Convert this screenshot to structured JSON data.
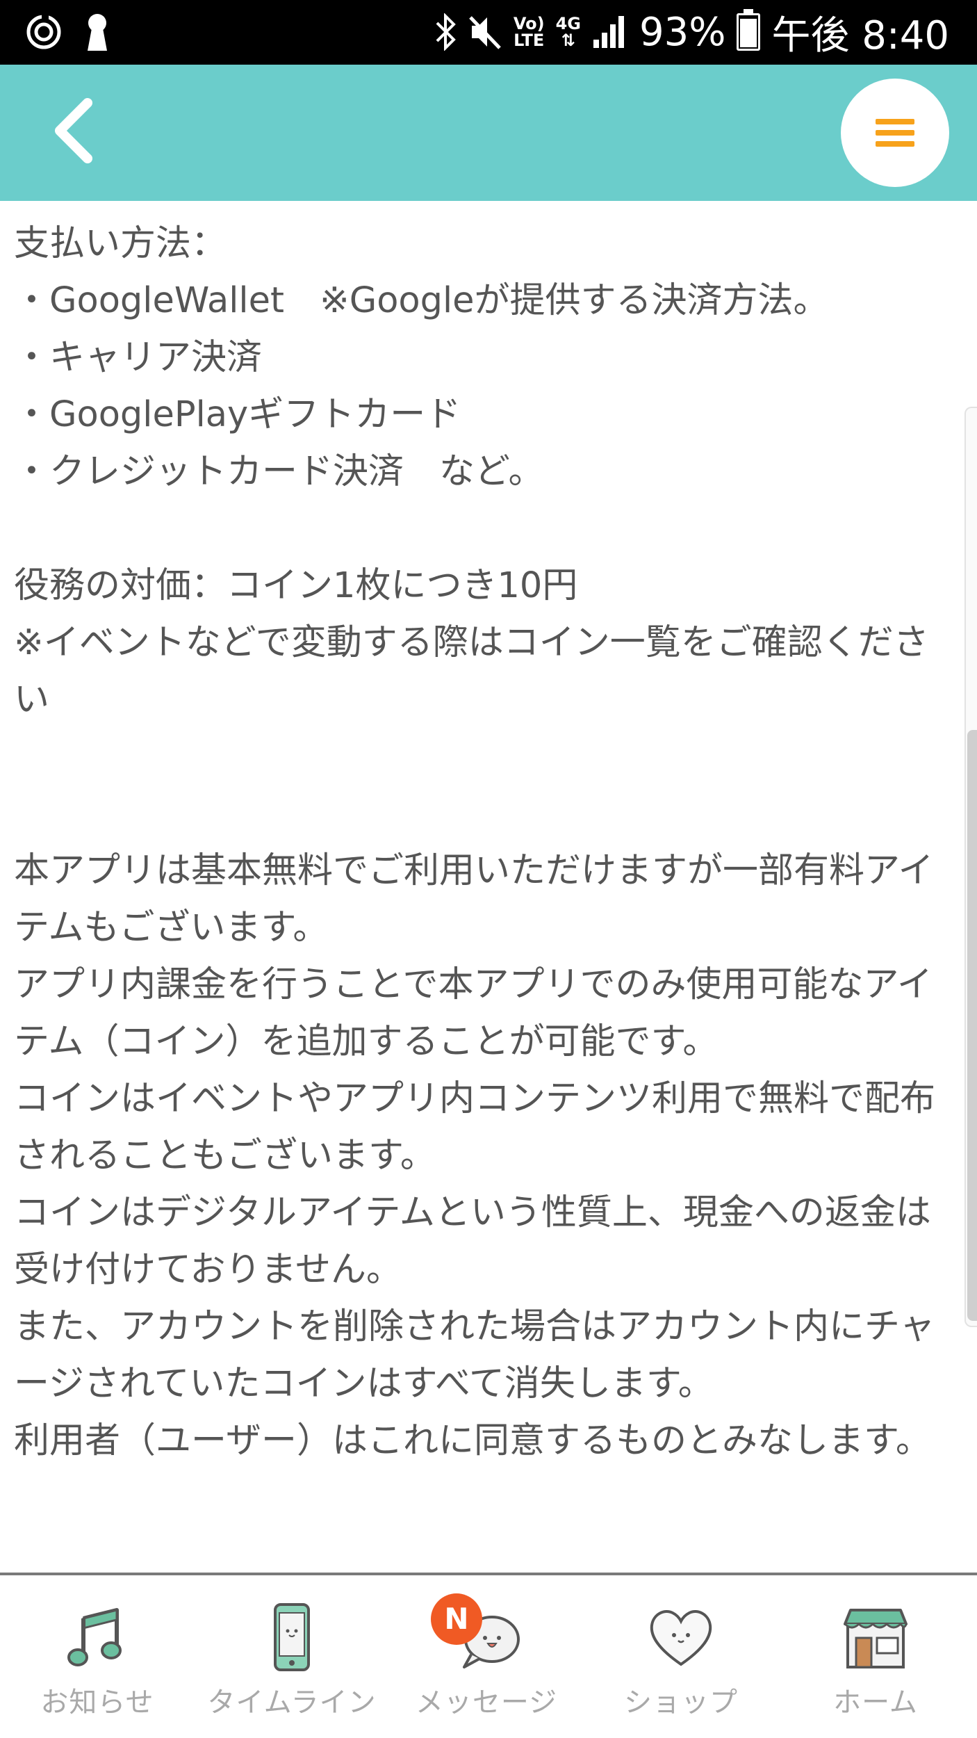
{
  "status_bar": {
    "battery": "93%",
    "time": "午後 8:40",
    "volte_line1": "Vo)",
    "volte_line2": "LTE",
    "network": "4G"
  },
  "header": {
    "back_icon": "chevron-left-icon",
    "menu_icon": "hamburger-menu-icon",
    "background_color": "#6bcdcb",
    "menu_color": "#f7a21b"
  },
  "content": {
    "payment_heading": "支払い方法：",
    "payment_methods": [
      "・GoogleWallet　※Googleが提供する決済方法。",
      "・キャリア決済",
      "・GooglePlayギフトカード",
      "・クレジットカード決済　など。"
    ],
    "price": "役務の対価：コイン1枚につき10円",
    "price_note": "※イベントなどで変動する際はコイン一覧をご確認ください",
    "paragraphs": [
      "本アプリは基本無料でご利用いただけますが一部有料アイテムもございます。",
      "アプリ内課金を行うことで本アプリでのみ使用可能なアイテム（コイン）を追加することが可能です。",
      "コインはイベントやアプリ内コンテンツ利用で無料で配布されることもございます。",
      "コインはデジタルアイテムという性質上、現金への返金は受け付けておりません。",
      "また、アカウントを削除された場合はアカウント内にチャージされていたコインはすべて消失します。",
      "利用者（ユーザー）はこれに同意するものとみなします。"
    ]
  },
  "bottom_nav": {
    "items": [
      {
        "label": "お知らせ",
        "icon": "music-note-icon"
      },
      {
        "label": "タイムライン",
        "icon": "smartphone-icon"
      },
      {
        "label": "メッセージ",
        "icon": "speech-bubble-icon",
        "badge": "N"
      },
      {
        "label": "ショップ",
        "icon": "heart-icon"
      },
      {
        "label": "ホーム",
        "icon": "storefront-icon"
      }
    ],
    "label_color": "#a9a9a9",
    "badge_color": "#f05a24"
  }
}
